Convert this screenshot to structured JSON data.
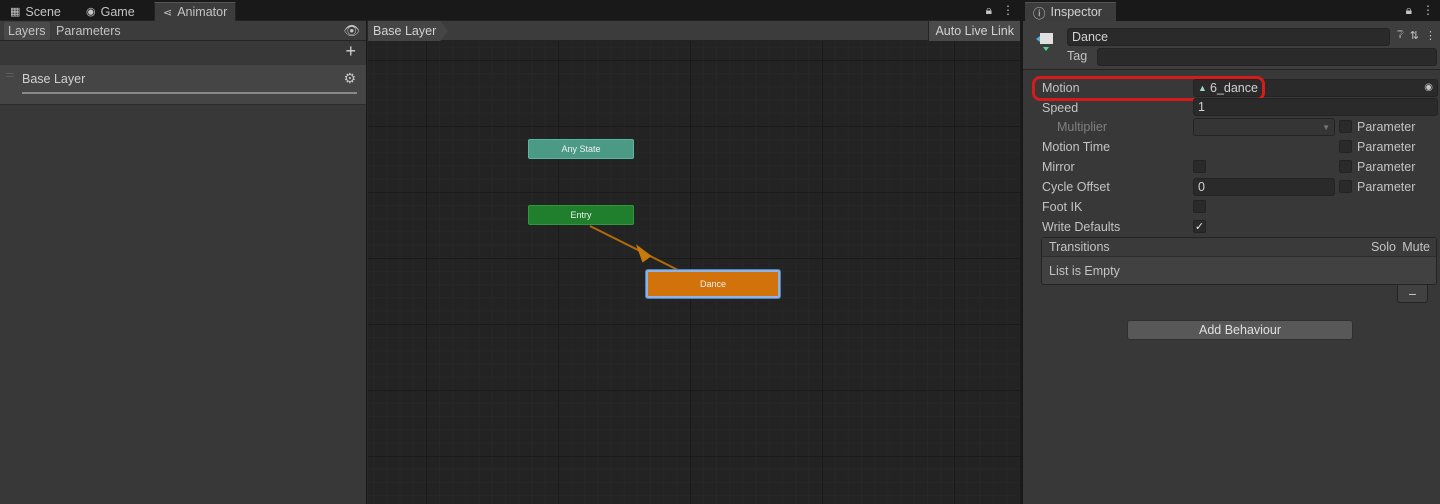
{
  "left_tabs": [
    {
      "label": "Scene",
      "icon": "grid-icon"
    },
    {
      "label": "Game",
      "icon": "gamepad-icon"
    },
    {
      "label": "Animator",
      "icon": "animator-icon"
    }
  ],
  "layers_panel": {
    "tabs": [
      "Layers",
      "Parameters"
    ],
    "layer_name": "Base Layer"
  },
  "graph": {
    "breadcrumb": "Base Layer",
    "auto_live_link": "Auto Live Link",
    "nodes": {
      "any_state": "Any State",
      "entry": "Entry",
      "dance": "Dance"
    }
  },
  "inspector": {
    "tab_label": "Inspector",
    "state_name": "Dance",
    "tag_label": "Tag",
    "properties": {
      "motion_label": "Motion",
      "motion_value": "6_dance",
      "speed_label": "Speed",
      "speed_value": "1",
      "multiplier_label": "Multiplier",
      "motion_time_label": "Motion Time",
      "mirror_label": "Mirror",
      "cycle_offset_label": "Cycle Offset",
      "cycle_offset_value": "0",
      "foot_ik_label": "Foot IK",
      "write_defaults_label": "Write Defaults",
      "parameter_label": "Parameter"
    },
    "transitions": {
      "title": "Transitions",
      "solo": "Solo",
      "mute": "Mute",
      "empty": "List is Empty",
      "remove": "−"
    },
    "add_behaviour": "Add Behaviour"
  },
  "colors": {
    "any_state": "#4b9a86",
    "entry": "#1f7f2d",
    "dance": "#d1720a",
    "highlight": "#d41c1c"
  }
}
